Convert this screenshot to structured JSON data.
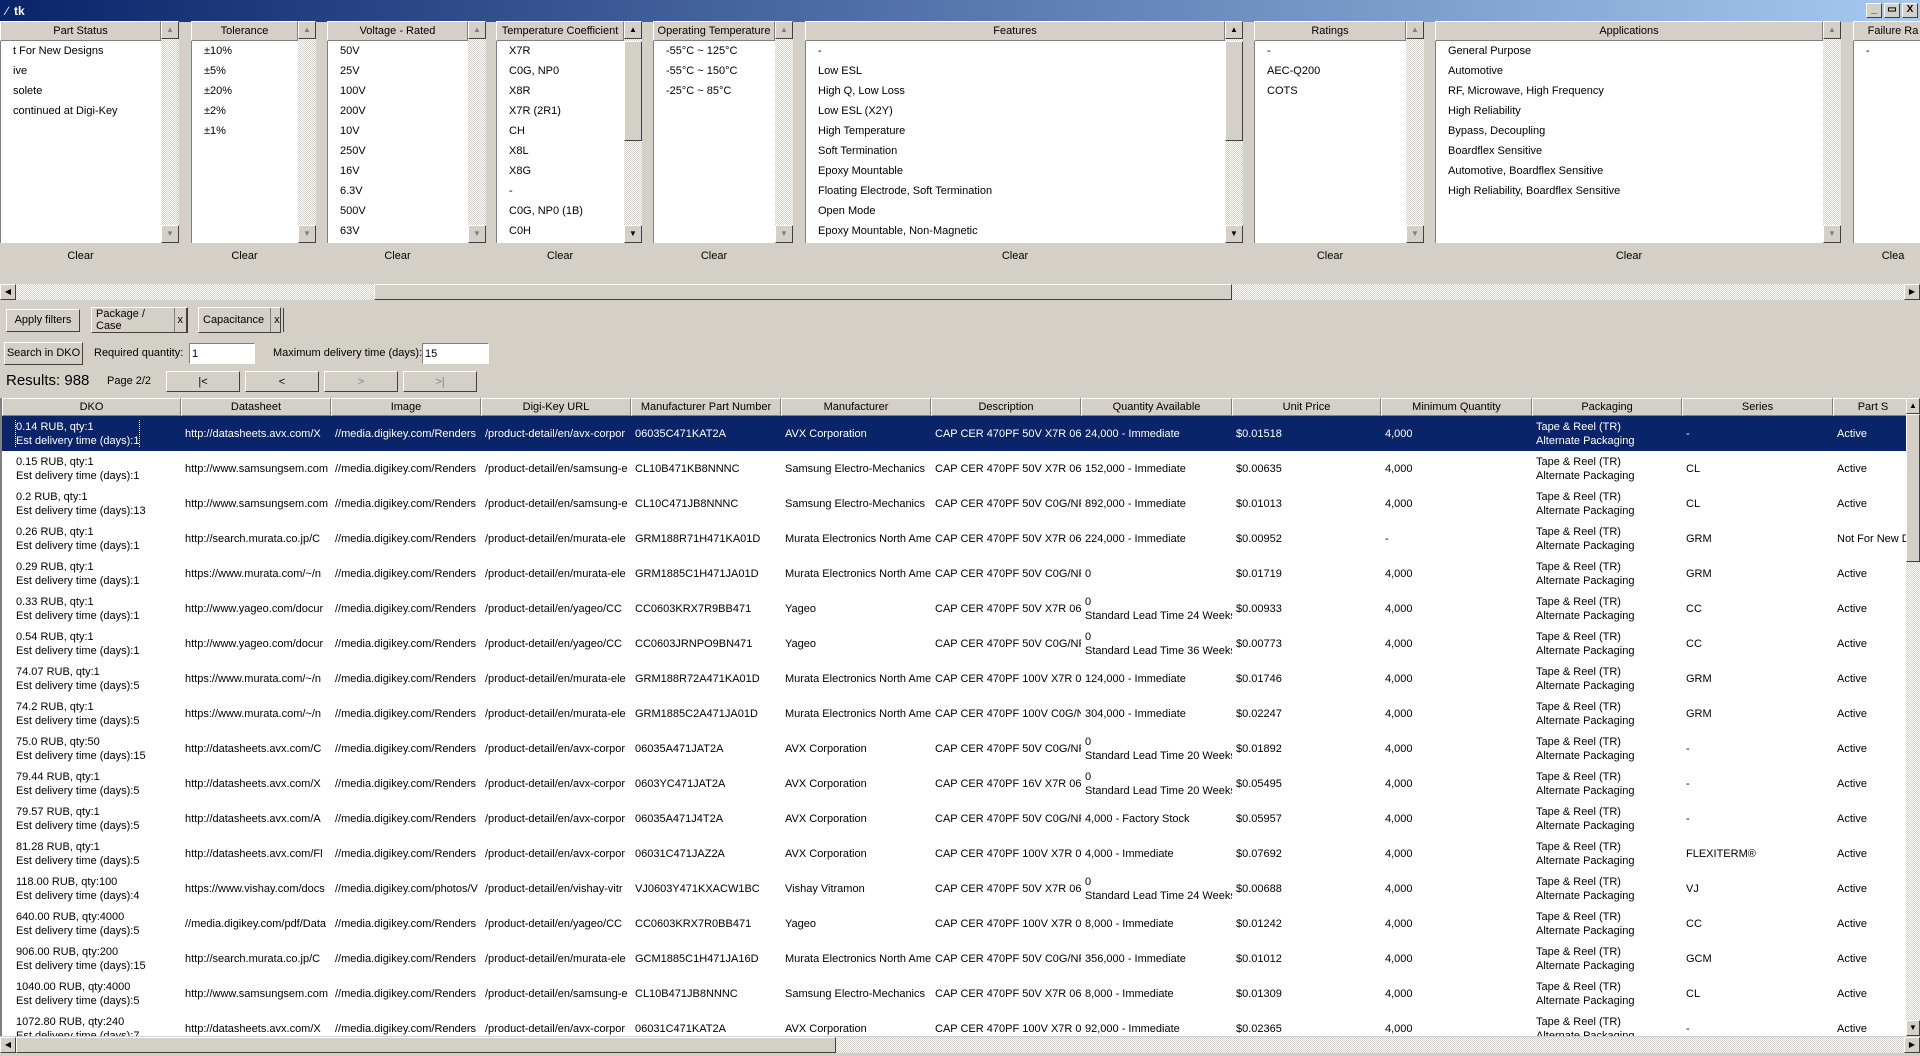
{
  "window": {
    "title": "tk",
    "icon": "feather-icon",
    "buttons": [
      "_",
      "▭",
      "X"
    ]
  },
  "colors": {
    "selection": "#0a246a",
    "face": "#d4d0c8",
    "title_start": "#0a246a",
    "title_end": "#a6caf0"
  },
  "filters": [
    {
      "header": "Part Status",
      "items": [
        "t For New Designs",
        "ive",
        "solete",
        "continued at Digi-Key"
      ],
      "clear": "Clear"
    },
    {
      "header": "Tolerance",
      "items": [
        "±10%",
        "±5%",
        "±20%",
        "±2%",
        "±1%"
      ],
      "clear": "Clear"
    },
    {
      "header": "Voltage - Rated",
      "items": [
        "50V",
        "25V",
        "100V",
        "200V",
        "10V",
        "250V",
        "16V",
        "6.3V",
        "500V",
        "63V"
      ],
      "clear": "Clear"
    },
    {
      "header": "Temperature Coefficient",
      "items": [
        "X7R",
        "C0G, NP0",
        "X8R",
        "X7R (2R1)",
        "CH",
        "X8L",
        "X8G",
        "-",
        "C0G, NP0 (1B)",
        "C0H"
      ],
      "clear": "Clear"
    },
    {
      "header": "Operating Temperature",
      "items": [
        "-55°C ~ 125°C",
        "-55°C ~ 150°C",
        "-25°C ~ 85°C"
      ],
      "clear": "Clear"
    },
    {
      "header": "Features",
      "items": [
        "-",
        "Low ESL",
        "High Q, Low Loss",
        "Low ESL (X2Y)",
        "High Temperature",
        "Soft Termination",
        "Epoxy Mountable",
        "Floating Electrode, Soft Termination",
        "Open Mode",
        "Epoxy Mountable, Non-Magnetic"
      ],
      "clear": "Clear"
    },
    {
      "header": "Ratings",
      "items": [
        "-",
        "AEC-Q200",
        "COTS"
      ],
      "clear": "Clear"
    },
    {
      "header": "Applications",
      "items": [
        "General Purpose",
        "Automotive",
        "RF, Microwave, High Frequency",
        "High Reliability",
        "Bypass, Decoupling",
        "Boardflex Sensitive",
        "Automotive, Boardflex Sensitive",
        "High Reliability, Boardflex Sensitive"
      ],
      "clear": "Clear"
    },
    {
      "header": "Failure Ra",
      "items": [
        "-"
      ],
      "clear": "Clea"
    }
  ],
  "controls": {
    "apply_filters": "Apply filters",
    "active_filters": [
      {
        "label": "Package / Case",
        "remove": "x"
      },
      {
        "label": "Capacitance",
        "remove": "x"
      }
    ],
    "search_dko": "Search in DKO",
    "required_quantity_label": "Required quantity:",
    "required_quantity": "1",
    "max_delivery_label": "Maximum delivery time (days):",
    "max_delivery": "15",
    "results": "Results: 988",
    "page": "Page 2/2",
    "nav": {
      "first": "|<",
      "prev": "<",
      "next": ">",
      "last": ">|"
    }
  },
  "table": {
    "columns": [
      "DKO",
      "Datasheet",
      "Image",
      "Digi-Key URL",
      "Manufacturer Part Number",
      "Manufacturer",
      "Description",
      "Quantity Available",
      "Unit Price",
      "Minimum Quantity",
      "Packaging",
      "Series",
      "Part S"
    ],
    "selected_row": 0,
    "rows": [
      [
        "0.14 RUB, qty:1\nEst delivery time (days):1",
        "http://datasheets.avx.com/X",
        "//media.digikey.com/Renders",
        "/product-detail/en/avx-corpor",
        "06035C471KAT2A",
        "AVX Corporation",
        "CAP CER 470PF 50V X7R 060",
        "24,000 - Immediate",
        "$0.01518",
        "4,000",
        "Tape & Reel (TR)\nAlternate Packaging",
        "-",
        "Active"
      ],
      [
        "0.15 RUB, qty:1\nEst delivery time (days):1",
        "http://www.samsungsem.com",
        "//media.digikey.com/Renders",
        "/product-detail/en/samsung-e",
        "CL10B471KB8NNNC",
        "Samsung Electro-Mechanics",
        "CAP CER 470PF 50V X7R 060",
        "152,000 - Immediate",
        "$0.00635",
        "4,000",
        "Tape & Reel (TR)\nAlternate Packaging",
        "CL",
        "Active"
      ],
      [
        "0.2 RUB, qty:1\nEst delivery time (days):13",
        "http://www.samsungsem.com",
        "//media.digikey.com/Renders",
        "/product-detail/en/samsung-e",
        "CL10C471JB8NNNC",
        "Samsung Electro-Mechanics",
        "CAP CER 470PF 50V C0G/NP0",
        "892,000 - Immediate",
        "$0.01013",
        "4,000",
        "Tape & Reel (TR)\nAlternate Packaging",
        "CL",
        "Active"
      ],
      [
        "0.26 RUB, qty:1\nEst delivery time (days):1",
        "http://search.murata.co.jp/C",
        "//media.digikey.com/Renders",
        "/product-detail/en/murata-ele",
        "GRM188R71H471KA01D",
        "Murata Electronics North Ame",
        "CAP CER 470PF 50V X7R 060",
        "224,000 - Immediate",
        "$0.00952",
        "-",
        "Tape & Reel (TR)\nAlternate Packaging",
        "GRM",
        "Not For New D"
      ],
      [
        "0.29 RUB, qty:1\nEst delivery time (days):1",
        "https://www.murata.com/~/n",
        "//media.digikey.com/Renders",
        "/product-detail/en/murata-ele",
        "GRM1885C1H471JA01D",
        "Murata Electronics North Ame",
        "CAP CER 470PF 50V C0G/NP0",
        "0",
        "$0.01719",
        "4,000",
        "Tape & Reel (TR)\nAlternate Packaging",
        "GRM",
        "Active"
      ],
      [
        "0.33 RUB, qty:1\nEst delivery time (days):1",
        "http://www.yageo.com/docur",
        "//media.digikey.com/Renders",
        "/product-detail/en/yageo/CC",
        "CC0603KRX7R9BB471",
        "Yageo",
        "CAP CER 470PF 50V X7R 060",
        "0\nStandard Lead Time 24 Weeks",
        "$0.00933",
        "4,000",
        "Tape & Reel (TR)\nAlternate Packaging",
        "CC",
        "Active"
      ],
      [
        "0.54 RUB, qty:1\nEst delivery time (days):1",
        "http://www.yageo.com/docur",
        "//media.digikey.com/Renders",
        "/product-detail/en/yageo/CC",
        "CC0603JRNPO9BN471",
        "Yageo",
        "CAP CER 470PF 50V C0G/NPC",
        "0\nStandard Lead Time 36 Weeks",
        "$0.00773",
        "4,000",
        "Tape & Reel (TR)\nAlternate Packaging",
        "CC",
        "Active"
      ],
      [
        "74.07 RUB, qty:1\nEst delivery time (days):5",
        "https://www.murata.com/~/n",
        "//media.digikey.com/Renders",
        "/product-detail/en/murata-ele",
        "GRM188R72A471KA01D",
        "Murata Electronics North Ame",
        "CAP CER 470PF 100V X7R 06",
        "124,000 - Immediate",
        "$0.01746",
        "4,000",
        "Tape & Reel (TR)\nAlternate Packaging",
        "GRM",
        "Active"
      ],
      [
        "74.2 RUB, qty:1\nEst delivery time (days):5",
        "https://www.murata.com/~/n",
        "//media.digikey.com/Renders",
        "/product-detail/en/murata-ele",
        "GRM1885C2A471JA01D",
        "Murata Electronics North Ame",
        "CAP CER 470PF 100V C0G/NP",
        "304,000 - Immediate",
        "$0.02247",
        "4,000",
        "Tape & Reel (TR)\nAlternate Packaging",
        "GRM",
        "Active"
      ],
      [
        "75.0 RUB, qty:50\nEst delivery time (days):15",
        "http://datasheets.avx.com/C",
        "//media.digikey.com/Renders",
        "/product-detail/en/avx-corpor",
        "06035A471JAT2A",
        "AVX Corporation",
        "CAP CER 470PF 50V C0G/NP0",
        "0\nStandard Lead Time 20 Weeks",
        "$0.01892",
        "4,000",
        "Tape & Reel (TR)\nAlternate Packaging",
        "-",
        "Active"
      ],
      [
        "79.44 RUB, qty:1\nEst delivery time (days):5",
        "http://datasheets.avx.com/X",
        "//media.digikey.com/Renders",
        "/product-detail/en/avx-corpor",
        "0603YC471JAT2A",
        "AVX Corporation",
        "CAP CER 470PF 16V X7R 060",
        "0\nStandard Lead Time 20 Weeks",
        "$0.05495",
        "4,000",
        "Tape & Reel (TR)\nAlternate Packaging",
        "-",
        "Active"
      ],
      [
        "79.57 RUB, qty:1\nEst delivery time (days):5",
        "http://datasheets.avx.com/A",
        "//media.digikey.com/Renders",
        "/product-detail/en/avx-corpor",
        "06035A471J4T2A",
        "AVX Corporation",
        "CAP CER 470PF 50V C0G/NP0",
        "4,000 - Factory Stock",
        "$0.05957",
        "4,000",
        "Tape & Reel (TR)\nAlternate Packaging",
        "-",
        "Active"
      ],
      [
        "81.28 RUB, qty:1\nEst delivery time (days):5",
        "http://datasheets.avx.com/Fl",
        "//media.digikey.com/Renders",
        "/product-detail/en/avx-corpor",
        "06031C471JAZ2A",
        "AVX Corporation",
        "CAP CER 470PF 100V X7R 06",
        "4,000 - Immediate",
        "$0.07692",
        "4,000",
        "Tape & Reel (TR)\nAlternate Packaging",
        "FLEXITERM®",
        "Active"
      ],
      [
        "118.00 RUB, qty:100\nEst delivery time (days):4",
        "https://www.vishay.com/docs",
        "//media.digikey.com/photos/V",
        "/product-detail/en/vishay-vitr",
        "VJ0603Y471KXACW1BC",
        "Vishay Vitramon",
        "CAP CER 470PF 50V X7R 060",
        "0\nStandard Lead Time 24 Weeks",
        "$0.00688",
        "4,000",
        "Tape & Reel (TR)\nAlternate Packaging",
        "VJ",
        "Active"
      ],
      [
        "640.00 RUB, qty:4000\nEst delivery time (days):5",
        "//media.digikey.com/pdf/Data",
        "//media.digikey.com/Renders",
        "/product-detail/en/yageo/CC",
        "CC0603KRX7R0BB471",
        "Yageo",
        "CAP CER 470PF 100V X7R 06",
        "8,000 - Immediate",
        "$0.01242",
        "4,000",
        "Tape & Reel (TR)\nAlternate Packaging",
        "CC",
        "Active"
      ],
      [
        "906.00 RUB, qty:200\nEst delivery time (days):15",
        "http://search.murata.co.jp/C",
        "//media.digikey.com/Renders",
        "/product-detail/en/murata-ele",
        "GCM1885C1H471JA16D",
        "Murata Electronics North Ame",
        "CAP CER 470PF 50V C0G/NP0",
        "356,000 - Immediate",
        "$0.01012",
        "4,000",
        "Tape & Reel (TR)\nAlternate Packaging",
        "GCM",
        "Active"
      ],
      [
        "1040.00 RUB, qty:4000\nEst delivery time (days):5",
        "http://www.samsungsem.com",
        "//media.digikey.com/Renders",
        "/product-detail/en/samsung-e",
        "CL10B471JB8NNNC",
        "Samsung Electro-Mechanics",
        "CAP CER 470PF 50V X7R 060",
        "8,000 - Immediate",
        "$0.01309",
        "4,000",
        "Tape & Reel (TR)\nAlternate Packaging",
        "CL",
        "Active"
      ],
      [
        "1072.80 RUB, qty:240\nEst delivery time (days):7",
        "http://datasheets.avx.com/X",
        "//media.digikey.com/Renders",
        "/product-detail/en/avx-corpor",
        "06031C471KAT2A",
        "AVX Corporation",
        "CAP CER 470PF 100V X7R 06",
        "92,000 - Immediate",
        "$0.02365",
        "4,000",
        "Tape & Reel (TR)\nAlternate Packaging",
        "-",
        "Active"
      ]
    ]
  }
}
